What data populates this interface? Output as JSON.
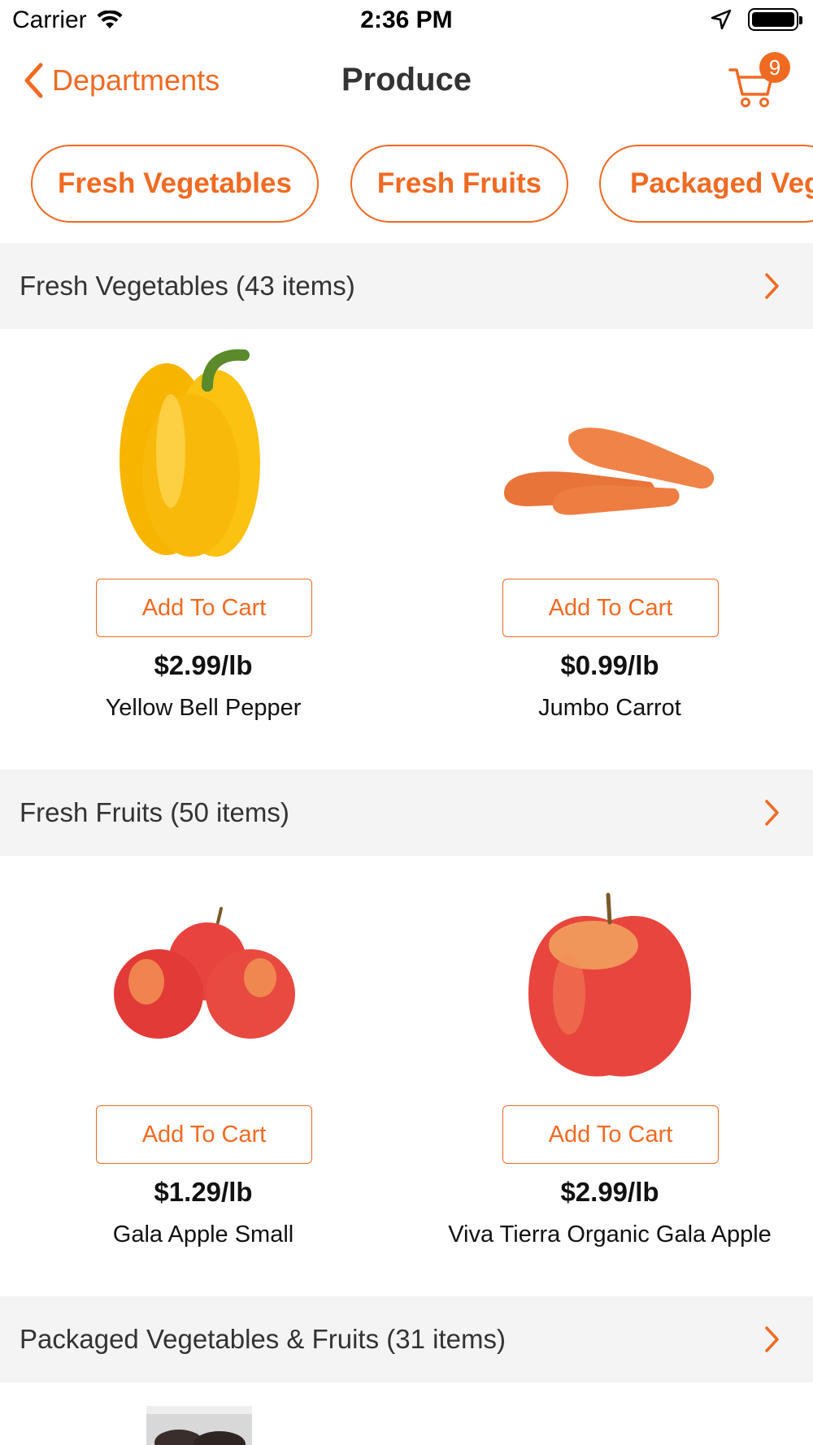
{
  "status_bar": {
    "carrier": "Carrier",
    "time": "2:36 PM"
  },
  "nav": {
    "back_label": "Departments",
    "title": "Produce",
    "cart_count": "9"
  },
  "chips": [
    "Fresh Vegetables",
    "Fresh Fruits",
    "Packaged Veg"
  ],
  "sections": [
    {
      "title": "Fresh Vegetables (43 items)",
      "products": [
        {
          "add_label": "Add To Cart",
          "price": "$2.99/lb",
          "name": "Yellow Bell Pepper",
          "image": "yellow-bell-pepper"
        },
        {
          "add_label": "Add To Cart",
          "price": "$0.99/lb",
          "name": "Jumbo Carrot",
          "image": "jumbo-carrot"
        }
      ]
    },
    {
      "title": "Fresh Fruits (50 items)",
      "products": [
        {
          "add_label": "Add To Cart",
          "price": "$1.29/lb",
          "name": "Gala Apple Small",
          "image": "gala-apple-small"
        },
        {
          "add_label": "Add To Cart",
          "price": "$2.99/lb",
          "name": "Viva Tierra Organic Gala Apple",
          "image": "organic-gala-apple"
        }
      ]
    },
    {
      "title": "Packaged Vegetables & Fruits (31 items)",
      "products": []
    }
  ],
  "colors": {
    "accent": "#f06a22",
    "section_bg": "#f4f4f4"
  }
}
